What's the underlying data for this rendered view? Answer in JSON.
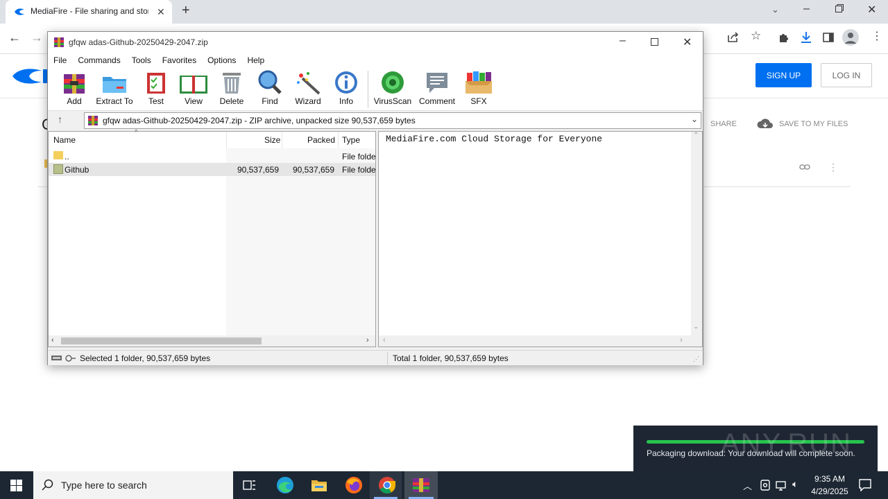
{
  "browser": {
    "tab_title": "MediaFire - File sharing and storage",
    "new_tab_symbol": "+"
  },
  "mediafire": {
    "signup_label": "SIGN UP",
    "login_label": "LOG IN",
    "share_label": "SHARE",
    "save_label": "SAVE TO MY FILES",
    "brand_color": "#0070f0"
  },
  "winrar": {
    "title": "gfqw adas-Github-20250429-2047.zip",
    "menu": [
      "File",
      "Commands",
      "Tools",
      "Favorites",
      "Options",
      "Help"
    ],
    "tools": [
      {
        "label": "Add",
        "icon": "add-archive-icon"
      },
      {
        "label": "Extract To",
        "icon": "extract-folder-icon"
      },
      {
        "label": "Test",
        "icon": "test-clipboard-icon"
      },
      {
        "label": "View",
        "icon": "view-book-icon"
      },
      {
        "label": "Delete",
        "icon": "trash-icon"
      },
      {
        "label": "Find",
        "icon": "magnifier-icon"
      },
      {
        "label": "Wizard",
        "icon": "wand-icon"
      },
      {
        "label": "Info",
        "icon": "info-icon"
      },
      {
        "label": "VirusScan",
        "icon": "virus-scan-icon"
      },
      {
        "label": "Comment",
        "icon": "comment-icon"
      },
      {
        "label": "SFX",
        "icon": "sfx-box-icon"
      }
    ],
    "address": "gfqw adas-Github-20250429-2047.zip - ZIP archive, unpacked size 90,537,659 bytes",
    "columns": [
      "Name",
      "Size",
      "Packed",
      "Type"
    ],
    "rows": [
      {
        "name": "..",
        "size": "",
        "packed": "",
        "type": "File folder"
      },
      {
        "name": "Github",
        "size": "90,537,659",
        "packed": "90,537,659",
        "type": "File folder"
      }
    ],
    "comment_text": "MediaFire.com Cloud Storage for Everyone",
    "status_left": "Selected 1 folder, 90,537,659 bytes",
    "status_right": "Total 1 folder, 90,537,659 bytes"
  },
  "toast": {
    "message": "Packaging download: Your download will complete soon.",
    "progress": 1.0,
    "watermark": "ANY.RUN"
  },
  "taskbar": {
    "search_placeholder": "Type here to search",
    "time": "9:35 AM",
    "date": "4/29/2025"
  }
}
